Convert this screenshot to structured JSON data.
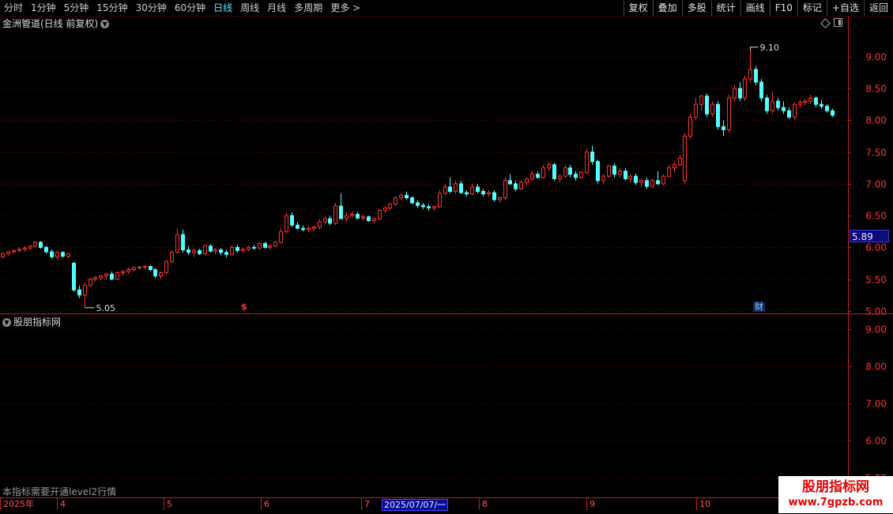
{
  "toolbar": {
    "periods": [
      "分时",
      "1分钟",
      "5分钟",
      "15分钟",
      "30分钟",
      "60分钟",
      "日线",
      "周线",
      "月线",
      "多周期",
      "更多 >"
    ],
    "active_period": "日线",
    "actions": [
      "复权",
      "叠加",
      "多股",
      "统计",
      "画线",
      "F10",
      "标记",
      "+自选",
      "返回"
    ]
  },
  "main_panel": {
    "title": "金洲管道(日线 前复权)",
    "high_label": "9.10",
    "low_label": "5.05",
    "current_price_badge": "5.89",
    "markers": {
      "s": "$",
      "cai": "财"
    }
  },
  "sub_panel": {
    "title": "股朋指标网",
    "note": "本指标需要开通level2行情"
  },
  "date_axis": {
    "ticks": [
      "2025年",
      "4",
      "5",
      "6",
      "7",
      "8",
      "9",
      "10"
    ],
    "cursor": "2025/07/07/一"
  },
  "watermark": {
    "name": "股朋指标网",
    "url": "www.7gpzb.com"
  },
  "colors": {
    "up": "#ff3232",
    "down": "#54ffff",
    "grid": "#7a0000",
    "axis": "#c02020",
    "badge": "#0a0a7a"
  },
  "chart_data": [
    {
      "type": "candlestick",
      "title": "金洲管道(日线 前复权)",
      "y_ticks": [
        "9.00",
        "8.50",
        "8.00",
        "7.50",
        "7.00",
        "6.50",
        "6.00",
        "5.50",
        "5.00"
      ],
      "ylim": [
        4.96,
        9.42
      ],
      "x_ticks": [
        "2025年",
        "4",
        "5",
        "6",
        "7",
        "8",
        "9",
        "10"
      ],
      "annotations": [
        {
          "label": "9.10",
          "type": "high"
        },
        {
          "label": "5.05",
          "type": "low"
        }
      ],
      "ohlc": [
        [
          5.85,
          5.92,
          5.83,
          5.9
        ],
        [
          5.9,
          5.95,
          5.87,
          5.93
        ],
        [
          5.93,
          5.97,
          5.9,
          5.95
        ],
        [
          5.95,
          6.0,
          5.92,
          5.97
        ],
        [
          5.97,
          6.02,
          5.93,
          5.99
        ],
        [
          5.99,
          6.04,
          5.96,
          6.02
        ],
        [
          6.02,
          6.1,
          6.0,
          6.08
        ],
        [
          6.08,
          6.1,
          5.98,
          6.0
        ],
        [
          6.0,
          6.02,
          5.9,
          5.93
        ],
        [
          5.93,
          5.97,
          5.82,
          5.85
        ],
        [
          5.85,
          5.95,
          5.8,
          5.92
        ],
        [
          5.92,
          5.94,
          5.84,
          5.86
        ],
        [
          5.86,
          5.92,
          5.82,
          5.9
        ],
        [
          5.75,
          5.77,
          5.3,
          5.33
        ],
        [
          5.33,
          5.4,
          5.2,
          5.25
        ],
        [
          5.25,
          5.45,
          5.05,
          5.4
        ],
        [
          5.4,
          5.52,
          5.38,
          5.5
        ],
        [
          5.5,
          5.55,
          5.46,
          5.52
        ],
        [
          5.52,
          5.57,
          5.48,
          5.55
        ],
        [
          5.55,
          5.6,
          5.5,
          5.58
        ],
        [
          5.58,
          5.62,
          5.48,
          5.5
        ],
        [
          5.5,
          5.62,
          5.48,
          5.6
        ],
        [
          5.6,
          5.65,
          5.55,
          5.62
        ],
        [
          5.62,
          5.68,
          5.58,
          5.65
        ],
        [
          5.65,
          5.7,
          5.62,
          5.68
        ],
        [
          5.68,
          5.71,
          5.65,
          5.69
        ],
        [
          5.69,
          5.72,
          5.65,
          5.7
        ],
        [
          5.7,
          5.72,
          5.62,
          5.65
        ],
        [
          5.65,
          5.67,
          5.52,
          5.55
        ],
        [
          5.55,
          5.62,
          5.5,
          5.6
        ],
        [
          5.6,
          5.8,
          5.58,
          5.78
        ],
        [
          5.78,
          5.95,
          5.75,
          5.92
        ],
        [
          5.92,
          6.3,
          5.9,
          6.2
        ],
        [
          6.2,
          6.28,
          5.92,
          5.96
        ],
        [
          5.96,
          6.02,
          5.88,
          5.92
        ],
        [
          5.92,
          5.98,
          5.85,
          5.95
        ],
        [
          5.95,
          5.98,
          5.88,
          5.9
        ],
        [
          5.9,
          6.05,
          5.88,
          6.02
        ],
        [
          6.02,
          6.05,
          5.92,
          5.94
        ],
        [
          5.94,
          5.99,
          5.9,
          5.96
        ],
        [
          5.96,
          5.99,
          5.88,
          5.92
        ],
        [
          5.92,
          5.96,
          5.84,
          5.89
        ],
        [
          5.89,
          6.03,
          5.87,
          6.0
        ],
        [
          6.0,
          6.04,
          5.92,
          5.95
        ],
        [
          5.95,
          5.99,
          5.9,
          5.97
        ],
        [
          5.97,
          6.03,
          5.94,
          6.0
        ],
        [
          6.0,
          6.04,
          5.96,
          5.99
        ],
        [
          5.99,
          6.08,
          5.96,
          6.06
        ],
        [
          6.06,
          6.09,
          5.98,
          6.0
        ],
        [
          6.0,
          6.05,
          5.96,
          6.02
        ],
        [
          6.02,
          6.1,
          6.0,
          6.08
        ],
        [
          6.08,
          6.3,
          6.06,
          6.25
        ],
        [
          6.25,
          6.55,
          6.22,
          6.5
        ],
        [
          6.5,
          6.55,
          6.32,
          6.35
        ],
        [
          6.35,
          6.4,
          6.28,
          6.3
        ],
        [
          6.3,
          6.35,
          6.25,
          6.28
        ],
        [
          6.28,
          6.35,
          6.24,
          6.3
        ],
        [
          6.3,
          6.34,
          6.26,
          6.32
        ],
        [
          6.32,
          6.45,
          6.28,
          6.4
        ],
        [
          6.4,
          6.48,
          6.36,
          6.45
        ],
        [
          6.45,
          6.5,
          6.35,
          6.38
        ],
        [
          6.38,
          6.7,
          6.35,
          6.65
        ],
        [
          6.65,
          6.85,
          6.6,
          6.45
        ],
        [
          6.45,
          6.55,
          6.4,
          6.5
        ],
        [
          6.5,
          6.56,
          6.46,
          6.52
        ],
        [
          6.52,
          6.56,
          6.44,
          6.46
        ],
        [
          6.46,
          6.52,
          6.42,
          6.48
        ],
        [
          6.48,
          6.5,
          6.4,
          6.42
        ],
        [
          6.42,
          6.48,
          6.38,
          6.45
        ],
        [
          6.45,
          6.6,
          6.43,
          6.58
        ],
        [
          6.58,
          6.65,
          6.54,
          6.62
        ],
        [
          6.62,
          6.7,
          6.58,
          6.68
        ],
        [
          6.68,
          6.8,
          6.65,
          6.78
        ],
        [
          6.78,
          6.85,
          6.74,
          6.82
        ],
        [
          6.82,
          6.88,
          6.75,
          6.78
        ],
        [
          6.78,
          6.8,
          6.68,
          6.7
        ],
        [
          6.7,
          6.74,
          6.62,
          6.66
        ],
        [
          6.66,
          6.7,
          6.6,
          6.64
        ],
        [
          6.64,
          6.68,
          6.58,
          6.62
        ],
        [
          6.62,
          6.66,
          6.58,
          6.64
        ],
        [
          6.64,
          6.9,
          6.62,
          6.85
        ],
        [
          6.85,
          7.0,
          6.82,
          6.95
        ],
        [
          6.95,
          7.1,
          6.85,
          6.88
        ],
        [
          6.88,
          7.05,
          6.84,
          7.0
        ],
        [
          7.0,
          7.05,
          6.84,
          6.86
        ],
        [
          6.86,
          6.9,
          6.8,
          6.84
        ],
        [
          6.84,
          7.0,
          6.82,
          6.95
        ],
        [
          6.95,
          7.0,
          6.85,
          6.88
        ],
        [
          6.88,
          6.92,
          6.8,
          6.84
        ],
        [
          6.84,
          6.9,
          6.8,
          6.86
        ],
        [
          6.86,
          6.9,
          6.72,
          6.75
        ],
        [
          6.75,
          6.8,
          6.7,
          6.78
        ],
        [
          6.78,
          7.1,
          6.75,
          7.05
        ],
        [
          7.05,
          7.15,
          6.98,
          7.0
        ],
        [
          7.0,
          7.05,
          6.88,
          6.92
        ],
        [
          6.92,
          7.05,
          6.9,
          7.02
        ],
        [
          7.02,
          7.1,
          6.98,
          7.08
        ],
        [
          7.08,
          7.2,
          7.05,
          7.15
        ],
        [
          7.15,
          7.2,
          7.08,
          7.1
        ],
        [
          7.1,
          7.3,
          7.08,
          7.25
        ],
        [
          7.25,
          7.35,
          7.2,
          7.3
        ],
        [
          7.3,
          7.33,
          7.05,
          7.08
        ],
        [
          7.08,
          7.15,
          7.02,
          7.12
        ],
        [
          7.12,
          7.3,
          7.1,
          7.25
        ],
        [
          7.25,
          7.3,
          7.1,
          7.15
        ],
        [
          7.15,
          7.2,
          7.05,
          7.1
        ],
        [
          7.1,
          7.2,
          7.08,
          7.18
        ],
        [
          7.18,
          7.55,
          7.15,
          7.5
        ],
        [
          7.5,
          7.6,
          7.3,
          7.35
        ],
        [
          7.35,
          7.38,
          7.0,
          7.05
        ],
        [
          7.05,
          7.15,
          7.0,
          7.12
        ],
        [
          7.12,
          7.3,
          7.1,
          7.28
        ],
        [
          7.28,
          7.32,
          7.1,
          7.15
        ],
        [
          7.15,
          7.25,
          7.1,
          7.2
        ],
        [
          7.2,
          7.25,
          7.05,
          7.08
        ],
        [
          7.08,
          7.15,
          7.02,
          7.12
        ],
        [
          7.12,
          7.16,
          6.98,
          7.02
        ],
        [
          7.02,
          7.08,
          6.95,
          7.05
        ],
        [
          7.05,
          7.1,
          6.92,
          6.96
        ],
        [
          6.96,
          7.08,
          6.94,
          7.05
        ],
        [
          7.05,
          7.2,
          6.98,
          7.0
        ],
        [
          7.0,
          7.15,
          6.98,
          7.12
        ],
        [
          7.12,
          7.3,
          7.1,
          7.25
        ],
        [
          7.25,
          7.35,
          7.18,
          7.3
        ],
        [
          7.3,
          7.45,
          7.28,
          7.4
        ],
        [
          7.05,
          7.8,
          7.0,
          7.75
        ],
        [
          7.75,
          8.1,
          7.7,
          8.05
        ],
        [
          8.05,
          8.35,
          8.0,
          8.25
        ],
        [
          8.25,
          8.4,
          8.15,
          8.38
        ],
        [
          8.38,
          8.42,
          8.05,
          8.1
        ],
        [
          8.1,
          8.3,
          8.05,
          8.25
        ],
        [
          8.25,
          8.3,
          7.85,
          7.9
        ],
        [
          7.9,
          8.0,
          7.75,
          7.85
        ],
        [
          7.85,
          8.4,
          7.8,
          8.35
        ],
        [
          8.35,
          8.55,
          8.3,
          8.5
        ],
        [
          8.5,
          8.6,
          8.3,
          8.35
        ],
        [
          8.35,
          8.7,
          8.3,
          8.65
        ],
        [
          8.65,
          9.1,
          8.6,
          8.8
        ],
        [
          8.8,
          8.85,
          8.55,
          8.6
        ],
        [
          8.6,
          8.65,
          8.3,
          8.35
        ],
        [
          8.35,
          8.4,
          8.1,
          8.15
        ],
        [
          8.15,
          8.45,
          8.1,
          8.3
        ],
        [
          8.3,
          8.35,
          8.15,
          8.2
        ],
        [
          8.2,
          8.3,
          8.1,
          8.15
        ],
        [
          8.15,
          8.2,
          8.02,
          8.05
        ],
        [
          8.05,
          8.28,
          8.0,
          8.25
        ],
        [
          8.25,
          8.32,
          8.2,
          8.28
        ],
        [
          8.28,
          8.33,
          8.23,
          8.3
        ],
        [
          8.3,
          8.4,
          8.25,
          8.35
        ],
        [
          8.35,
          8.38,
          8.2,
          8.25
        ],
        [
          8.25,
          8.32,
          8.18,
          8.22
        ],
        [
          8.22,
          8.25,
          8.12,
          8.15
        ],
        [
          8.15,
          8.18,
          8.05,
          8.08
        ]
      ]
    },
    {
      "type": "line",
      "title": "股朋指标网",
      "y_ticks": [
        "9.00",
        "8.00",
        "7.00",
        "6.00",
        "5.00"
      ],
      "ylim": [
        4.9,
        9.4
      ],
      "series": []
    }
  ]
}
